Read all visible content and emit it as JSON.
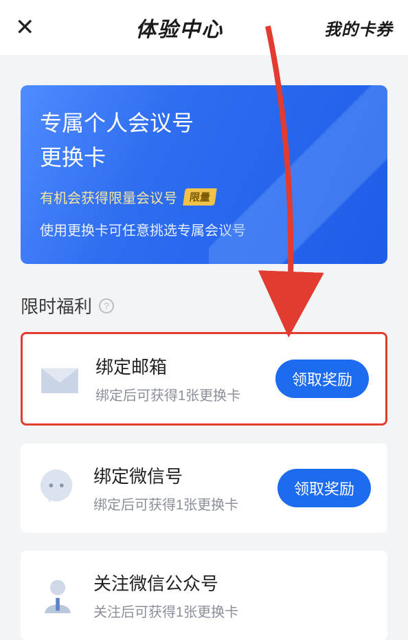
{
  "header": {
    "title": "体验中心",
    "right": "我的卡券"
  },
  "banner": {
    "line1": "专属个人会议号",
    "line2": "更换卡",
    "sub": "有机会获得限量会议号",
    "badge": "限量",
    "desc": "使用更换卡可任意挑选专属会议号"
  },
  "section": {
    "title": "限时福利",
    "help": "?"
  },
  "cards": [
    {
      "title": "绑定邮箱",
      "sub": "绑定后可获得1张更换卡",
      "btn": "领取奖励"
    },
    {
      "title": "绑定微信号",
      "sub": "绑定后可获得1张更换卡",
      "btn": "领取奖励"
    },
    {
      "title": "关注微信公众号",
      "sub": "关注后可获得1张更换卡",
      "btn": ""
    }
  ]
}
